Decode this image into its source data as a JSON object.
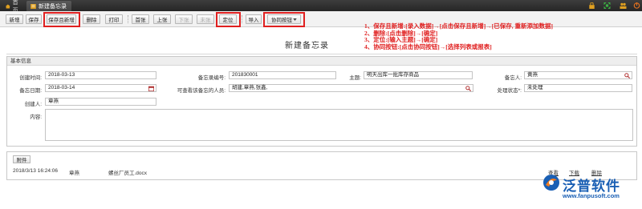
{
  "tabs": {
    "home": "首页",
    "active": "新建备忘录"
  },
  "colors": {
    "topbar": "#2e2e2e",
    "highlight": "#e02020",
    "logo": "#1a5fb4",
    "icon_gold": "#e0a020",
    "icon_green": "#3cb043"
  },
  "toolbar": {
    "new": "新增",
    "save": "保存",
    "save_and_new": "保存且新增",
    "delete": "删除",
    "print": "打印",
    "first": "首张",
    "prev": "上张",
    "next": "下张",
    "last": "末张",
    "locate": "定位",
    "import": "导入",
    "collab": "协同按钮"
  },
  "notes": [
    "1、保存且新增:[录入数据]→[点击保存且新增]→[已保存, 重新添加数据]",
    "2、删除:[点击删除]→[确定]",
    "3、定位:[输入主题]→[确定]",
    "4、协同按钮:[点击协同按钮]→[选择列表或报表]"
  ],
  "form": {
    "title": "新建备忘录",
    "section_basic": "基本信息",
    "create_time_label": "创建时间:",
    "create_time": "2018-03-13",
    "memo_no_label": "备忘录编号:",
    "memo_no": "201830001",
    "subject_label": "主题:",
    "subject": "明天出库一批库存商品",
    "memo_person_label": "备忘人:",
    "memo_person": "黄燕",
    "memo_date_label": "备忘日期:",
    "memo_date": "2018-03-14",
    "viewers_label": "可查看该备忘的人员:",
    "viewers": "胡建,章燕,张鑫,",
    "status_label": "处理状态*:",
    "status": "未处理",
    "creator_label": "创建人:",
    "creator": "章燕",
    "content_label": "内容:",
    "content": ""
  },
  "attachments": {
    "section": "附件",
    "button": "附件",
    "rows": [
      {
        "time": "2018/3/13 16:24:06",
        "uploader": "章燕",
        "filename": "螺丝厂员工.docx",
        "view": "查看",
        "download": "下载",
        "delete": "删除"
      }
    ]
  },
  "logo": {
    "name": "泛普软件",
    "url": "www.fanpusoft.com"
  }
}
